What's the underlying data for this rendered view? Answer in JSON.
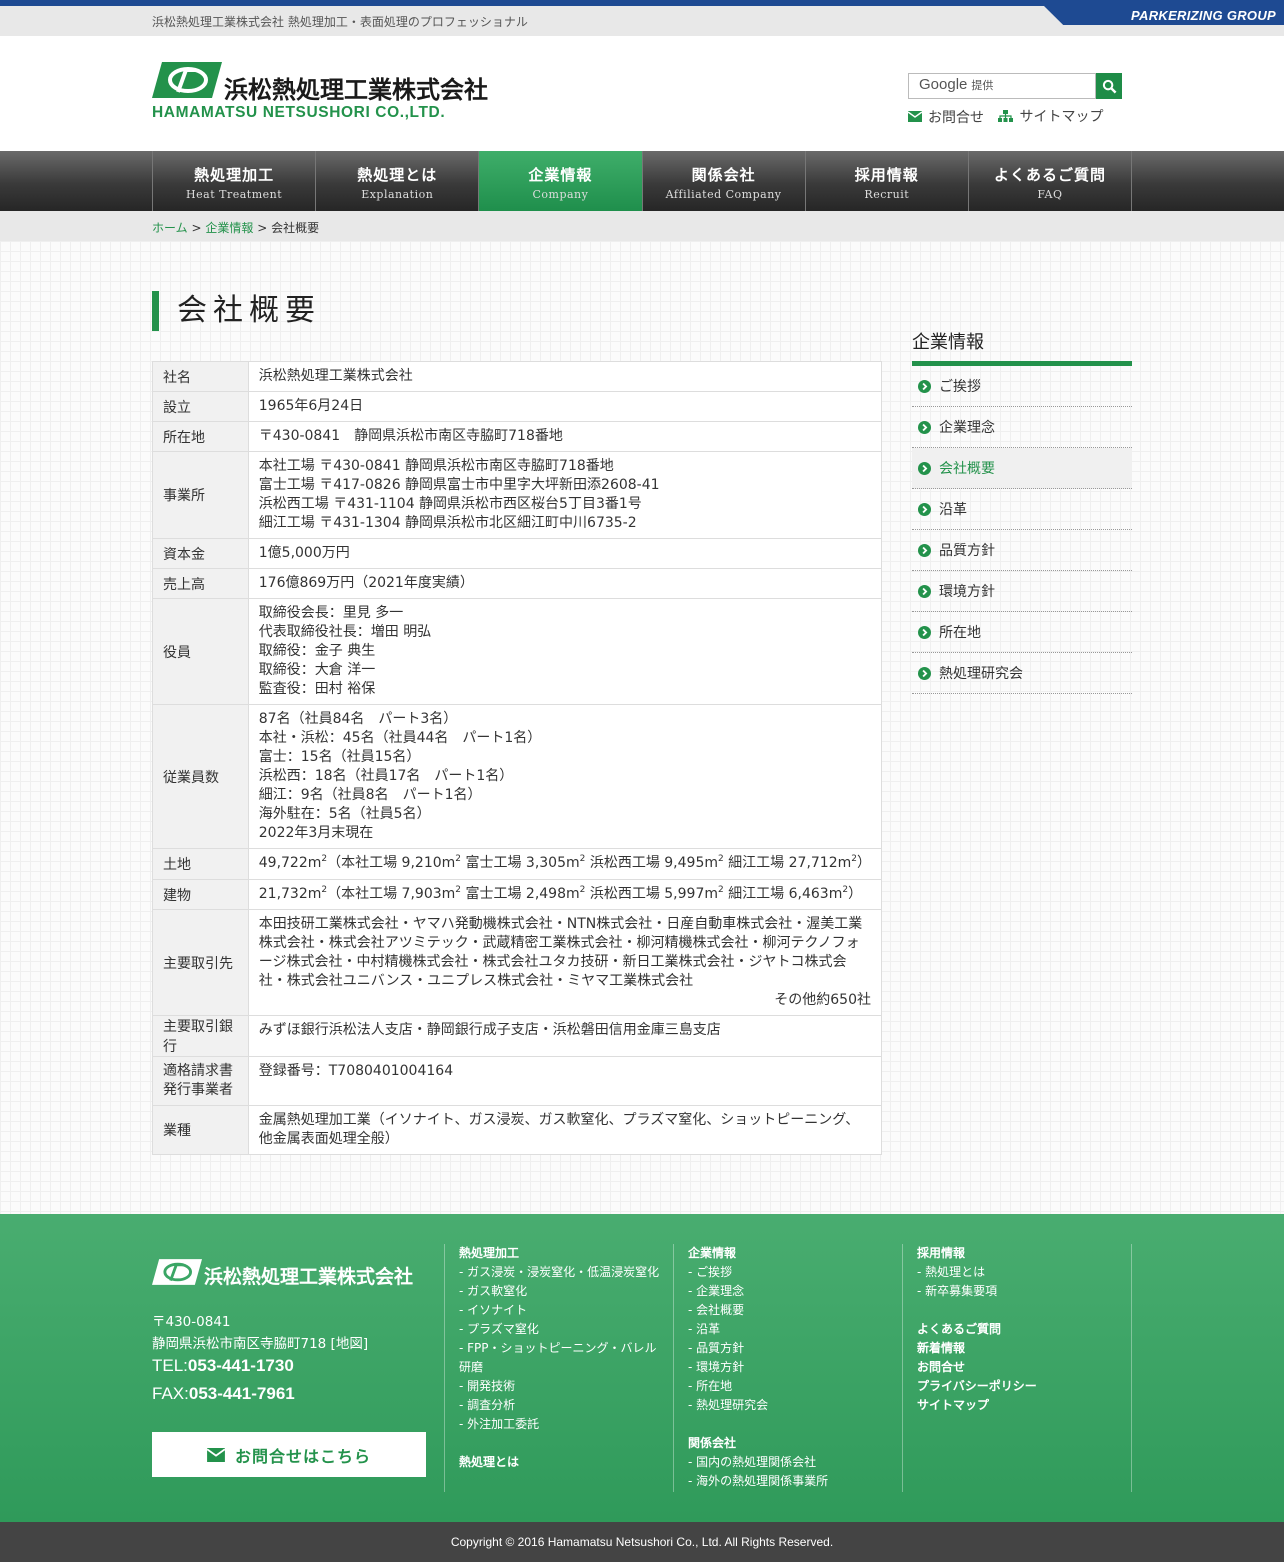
{
  "top": {
    "tagline": "浜松熱処理工業株式会社 熱処理加工・表面処理のプロフェッショナル",
    "group": "PARKERIZING GROUP"
  },
  "header": {
    "logo_jp": "浜松熱処理工業株式会社",
    "logo_en": "HAMAMATSU NETSUSHORI CO.,LTD.",
    "search_placeholder_brand": "Google",
    "search_placeholder_suffix": "提供",
    "contact_link": "お問合せ",
    "sitemap_link": "サイトマップ"
  },
  "nav": [
    {
      "jp": "熱処理加工",
      "en": "Heat Treatment"
    },
    {
      "jp": "熱処理とは",
      "en": "Explanation"
    },
    {
      "jp": "企業情報",
      "en": "Company"
    },
    {
      "jp": "関係会社",
      "en": "Affiliated Company"
    },
    {
      "jp": "採用情報",
      "en": "Recruit"
    },
    {
      "jp": "よくあるご質問",
      "en": "FAQ"
    }
  ],
  "breadcrumb": {
    "home": "ホーム",
    "sep": ">",
    "section": "企業情報",
    "current": "会社概要"
  },
  "page_title": "会社概要",
  "info": [
    {
      "label": "社名",
      "lines": [
        "浜松熱処理工業株式会社"
      ]
    },
    {
      "label": "設立",
      "lines": [
        "1965年6月24日"
      ]
    },
    {
      "label": "所在地",
      "lines": [
        "〒430-0841　静岡県浜松市南区寺脇町718番地"
      ]
    },
    {
      "label": "事業所",
      "lines": [
        "本社工場 〒430-0841 静岡県浜松市南区寺脇町718番地",
        "富士工場 〒417-0826 静岡県富士市中里字大坪新田添2608-41",
        "浜松西工場 〒431-1104 静岡県浜松市西区桜台5丁目3番1号",
        "細江工場 〒431-1304 静岡県浜松市北区細江町中川6735-2"
      ]
    },
    {
      "label": "資本金",
      "lines": [
        "1億5,000万円"
      ]
    },
    {
      "label": "売上高",
      "lines": [
        "176億869万円（2021年度実績）"
      ]
    },
    {
      "label": "役員",
      "lines": [
        "取締役会長：里見 多一",
        "代表取締役社長：増田 明弘",
        "取締役：金子 典生",
        "取締役：大倉 洋一",
        "監査役：田村 裕保"
      ]
    },
    {
      "label": "従業員数",
      "lines": [
        "87名（社員84名　パート3名）",
        "本社・浜松：45名（社員44名　パート1名）",
        "富士：15名（社員15名）",
        "浜松西：18名（社員17名　パート1名）",
        "細江：9名（社員8名　パート1名）",
        "海外駐在：5名（社員5名）",
        "2022年3月末現在"
      ]
    },
    {
      "label": "土地",
      "area": [
        [
          "49,722m",
          "（本社工場 9,210m",
          " 富士工場 3,305m",
          " 浜松西工場 9,495m",
          " 細江工場 27,712m",
          "）"
        ]
      ]
    },
    {
      "label": "建物",
      "area": [
        [
          "21,732m",
          "（本社工場 7,903m",
          " 富士工場 2,498m",
          " 浜松西工場 5,997m",
          " 細江工場 6,463m",
          "）"
        ]
      ]
    },
    {
      "label": "主要取引先",
      "para": "本田技研工業株式会社・ヤマハ発動機株式会社・NTN株式会社・日産自動車株式会社・渥美工業株式会社・株式会社アツミテック・武蔵精密工業株式会社・柳河精機株式会社・柳河テクノフォージ株式会社・中村精機株式会社・株式会社ユタカ技研・新日工業株式会社・ジヤトコ株式会社・株式会社ユニバンス・ユニプレス株式会社・ミヤマ工業株式会社",
      "right": "その他約650社"
    },
    {
      "label": "主要取引銀行",
      "lines": [
        "みずほ銀行浜松法人支店・静岡銀行成子支店・浜松磐田信用金庫三島支店"
      ]
    },
    {
      "label": "適格請求書発行事業者",
      "label_lines": [
        "適格請求書",
        "発行事業者"
      ],
      "lines": [
        "登録番号：T7080401004164"
      ]
    },
    {
      "label": "業種",
      "para": "金属熱処理加工業（イソナイト、ガス浸炭、ガス軟窒化、プラズマ窒化、ショットピーニング、他金属表面処理全般）"
    }
  ],
  "sidebar": {
    "title": "企業情報",
    "items": [
      "ご挨拶",
      "企業理念",
      "会社概要",
      "沿革",
      "品質方針",
      "環境方針",
      "所在地",
      "熱処理研究会"
    ],
    "active": "会社概要"
  },
  "footer": {
    "logo_jp": "浜松熱処理工業株式会社",
    "zip": "〒430-0841",
    "address": "静岡県浜松市南区寺脇町718 [地図]",
    "tel_label": "TEL:",
    "tel": "053-441-1730",
    "fax_label": "FAX:",
    "fax": "053-441-7961",
    "contact_button": "お問合せはこちら",
    "col1": {
      "heading": "熱処理加工",
      "items": [
        "ガス浸炭・浸炭窒化・低温浸炭窒化",
        "ガス軟窒化",
        "イソナイト",
        "プラズマ窒化",
        "FPP・ショットピーニング・バレル",
        "研磨",
        "開発技術",
        "調査分析",
        "外注加工委託"
      ],
      "heading2": "熱処理とは"
    },
    "col2": {
      "heading": "企業情報",
      "items": [
        "ご挨拶",
        "企業理念",
        "会社概要",
        "沿革",
        "品質方針",
        "環境方針",
        "所在地",
        "熱処理研究会"
      ],
      "heading2": "関係会社",
      "items2": [
        "国内の熱処理関係会社",
        "海外の熱処理関係事業所"
      ]
    },
    "col3": {
      "heading": "採用情報",
      "items": [
        "熱処理とは",
        "新卒募集要項"
      ],
      "links": [
        "よくあるご質問",
        "新着情報",
        "お問合せ",
        "プライバシーポリシー",
        "サイトマップ"
      ]
    },
    "copyright": "Copyright © 2016 Hamamatsu Netsushori Co., Ltd. All Rights Reserved."
  },
  "colors": {
    "brand_green": "#23924b",
    "top_blue": "#1e4a92"
  }
}
